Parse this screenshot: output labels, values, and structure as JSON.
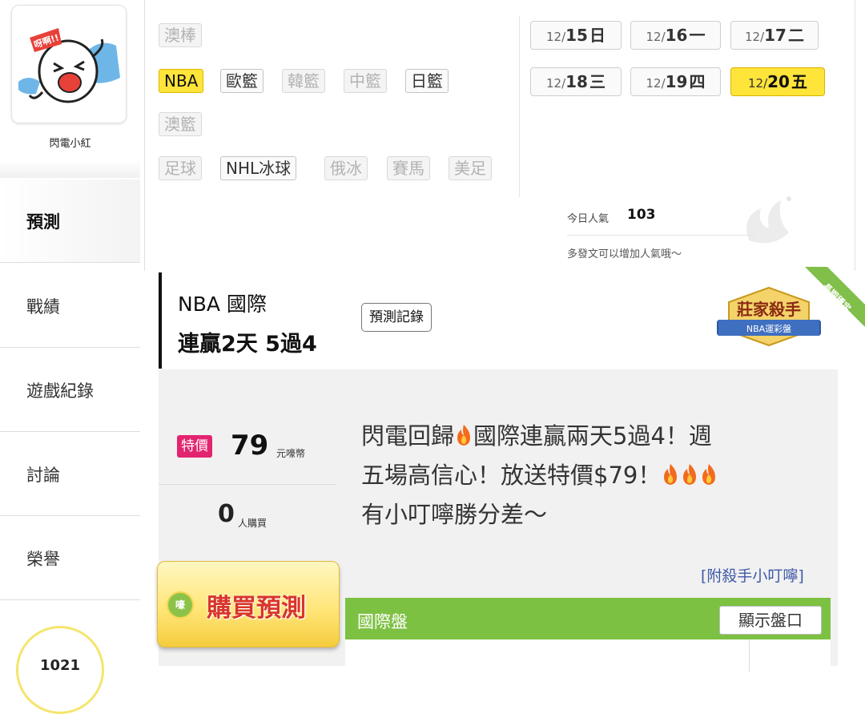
{
  "profile": {
    "name": "閃電小紅",
    "sticker_text": "呀啊!!"
  },
  "nav": {
    "items": [
      {
        "label": "預測",
        "active": true
      },
      {
        "label": "戰績",
        "active": false
      },
      {
        "label": "遊戲紀錄",
        "active": false
      },
      {
        "label": "討論",
        "active": false
      },
      {
        "label": "榮譽",
        "active": false
      }
    ],
    "badge_number": "1021"
  },
  "leagues": {
    "items": [
      {
        "label": "澳棒",
        "state": "off"
      },
      {
        "label": "NBA",
        "state": "selected"
      },
      {
        "label": "歐籃",
        "state": "on"
      },
      {
        "label": "韓籃",
        "state": "off"
      },
      {
        "label": "中籃",
        "state": "off"
      },
      {
        "label": "日籃",
        "state": "on"
      },
      {
        "label": "澳籃",
        "state": "off"
      },
      {
        "label": "足球",
        "state": "off"
      },
      {
        "label": "NHL冰球",
        "state": "on"
      },
      {
        "label": "俄冰",
        "state": "off"
      },
      {
        "label": "賽馬",
        "state": "off"
      },
      {
        "label": "美足",
        "state": "off"
      }
    ]
  },
  "dates": {
    "items": [
      {
        "month": "12/",
        "day": "15",
        "weekday": "日",
        "selected": false
      },
      {
        "month": "12/",
        "day": "16",
        "weekday": "一",
        "selected": false
      },
      {
        "month": "12/",
        "day": "17",
        "weekday": "二",
        "selected": false
      },
      {
        "month": "12/",
        "day": "18",
        "weekday": "三",
        "selected": false
      },
      {
        "month": "12/",
        "day": "19",
        "weekday": "四",
        "selected": false
      },
      {
        "month": "12/",
        "day": "20",
        "weekday": "五",
        "selected": true
      }
    ]
  },
  "popularity": {
    "label": "今日人氣",
    "value": "103",
    "hint": "多發文可以增加人氣哦～"
  },
  "record": {
    "league": "NBA 國際",
    "streak": "連贏2天 5過4",
    "history_button": "預測記錄",
    "badge_title": "莊家殺手",
    "badge_sub": "NBA運彩盤",
    "ribbon": "長期穩定"
  },
  "prediction": {
    "special_tag": "特價",
    "price": "79",
    "price_unit": "元嚎幣",
    "buyers": "0",
    "buyers_unit": "人購買",
    "text_line1_a": "閃電回歸",
    "text_line1_b": "國際連贏兩天5過4！週",
    "text_line2": "五場高信心！放送特價$79！",
    "text_line3": "有小叮嚀勝分差～",
    "attachment": "[附殺手小叮嚀]",
    "buy_button": "購買預測",
    "coin_text": "嚎",
    "market_label": "國際盤",
    "show_odds_button": "顯示盤口"
  },
  "colors": {
    "highlight": "#ffe43a",
    "special": "#e3246f",
    "green_bar": "#7dc142",
    "buy_red": "#d9352a"
  }
}
